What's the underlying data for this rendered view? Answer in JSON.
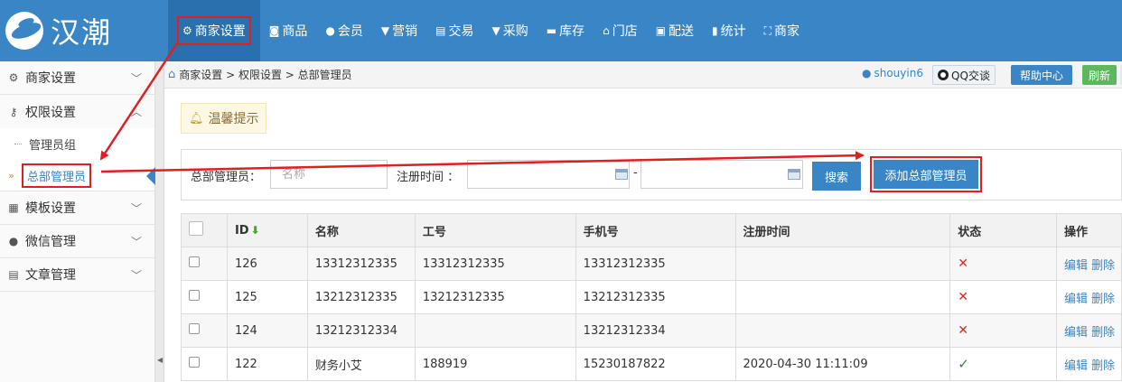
{
  "app": {
    "logo_text": "汉潮"
  },
  "nav": {
    "items": [
      {
        "label": "商家设置",
        "icon": "gear-icon"
      },
      {
        "label": "商品",
        "icon": "box-icon"
      },
      {
        "label": "会员",
        "icon": "user-icon"
      },
      {
        "label": "营销",
        "icon": "cup-icon"
      },
      {
        "label": "交易",
        "icon": "document-icon"
      },
      {
        "label": "采购",
        "icon": "cart-icon"
      },
      {
        "label": "库存",
        "icon": "storage-icon"
      },
      {
        "label": "门店",
        "icon": "home-icon"
      },
      {
        "label": "配送",
        "icon": "truck-icon"
      },
      {
        "label": "统计",
        "icon": "chart-icon"
      },
      {
        "label": "商家",
        "icon": "shop-icon"
      }
    ]
  },
  "sidebar": {
    "groups": [
      {
        "label": "商家设置",
        "icon": "gear-icon"
      },
      {
        "label": "权限设置",
        "icon": "key-icon"
      }
    ],
    "sub_items": [
      {
        "label": "管理员组"
      },
      {
        "label": "总部管理员"
      }
    ],
    "more_groups": [
      {
        "label": "模板设置",
        "icon": "template-icon"
      },
      {
        "label": "微信管理",
        "icon": "wechat-icon"
      },
      {
        "label": "文章管理",
        "icon": "article-icon"
      }
    ]
  },
  "breadcrumb": {
    "text": "商家设置 > 权限设置 > 总部管理员"
  },
  "header_right": {
    "username": "shouyin6",
    "qq_label": "QQ交谈",
    "help_label": "帮助中心",
    "refresh_label": "刷新"
  },
  "tip": {
    "label": "温馨提示"
  },
  "search": {
    "admin_label": "总部管理员：",
    "name_placeholder": "名称",
    "reg_time_label": "注册时间 ：",
    "range_sep": "-",
    "search_button": "搜索",
    "add_button": "添加总部管理员"
  },
  "table": {
    "headers": [
      "ID",
      "名称",
      "工号",
      "手机号",
      "注册时间",
      "状态",
      "操作"
    ],
    "rows": [
      {
        "id": "126",
        "name": "13312312335",
        "job_no": "13312312335",
        "phone": "13312312335",
        "reg_time": "",
        "status": "✕",
        "edit": "编辑",
        "delete": "删除"
      },
      {
        "id": "125",
        "name": "13212312335",
        "job_no": "13212312335",
        "phone": "13212312335",
        "reg_time": "",
        "status": "✕",
        "edit": "编辑",
        "delete": "删除"
      },
      {
        "id": "124",
        "name": "13212312334",
        "job_no": "",
        "phone": "13212312334",
        "reg_time": "",
        "status": "✕",
        "edit": "编辑",
        "delete": "删除"
      },
      {
        "id": "122",
        "name": "财务小艾",
        "job_no": "188919",
        "phone": "15230187822",
        "reg_time": "2020-04-30 11:11:09",
        "status": "✓",
        "edit": "编辑",
        "delete": "删除"
      }
    ]
  },
  "colors": {
    "primary": "#3a85c6",
    "annotation": "#e02020",
    "success": "#5cb85c"
  }
}
